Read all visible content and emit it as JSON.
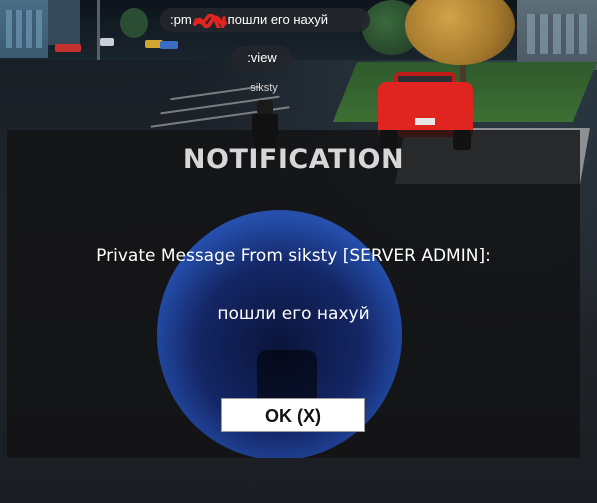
{
  "world": {
    "chat_bubble": {
      "prefix": ":pm",
      "message": "пошли его нахуй"
    },
    "view_bubble": ":view",
    "player_name": "siksty"
  },
  "notification": {
    "title": "NOTIFICATION",
    "header": "Private Message From siksty [SERVER ADMIN]:",
    "body": "пошли его нахуй",
    "ok_button_label": "OK (X)"
  },
  "colors": {
    "overlay": "#121214",
    "orb_blue": "#2a5ad0",
    "scribble_red": "#e0241f",
    "button_bg": "#ffffff"
  }
}
